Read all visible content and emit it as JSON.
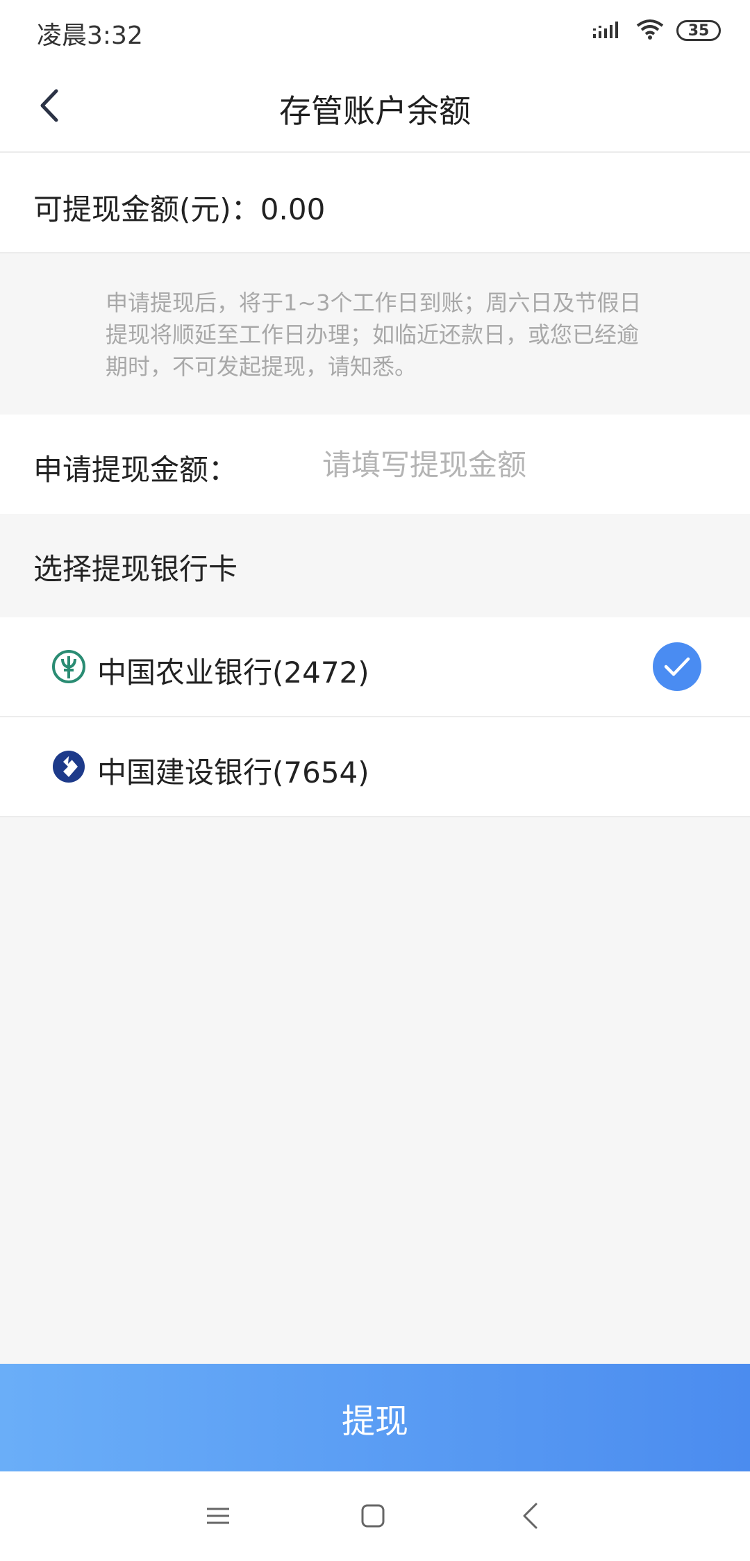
{
  "status_bar": {
    "time": "凌晨3:32",
    "battery": "35"
  },
  "header": {
    "title": "存管账户余额"
  },
  "balance": {
    "label": "可提现金额(元)：0.00"
  },
  "notice": {
    "text": "申请提现后，将于1~3个工作日到账；周六日及节假日提现将顺延至工作日办理；如临近还款日，或您已经逾期时，不可发起提现，请知悉。"
  },
  "withdraw_form": {
    "label": "申请提现金额：",
    "placeholder": "请填写提现金额",
    "value": ""
  },
  "bank_section": {
    "title": "选择提现银行卡",
    "cards": [
      {
        "name": "中国农业银行(2472)",
        "icon": "abc-bank-logo-icon",
        "selected": true,
        "color": "#2a8c73"
      },
      {
        "name": "中国建设银行(7654)",
        "icon": "ccb-bank-logo-icon",
        "selected": false,
        "color": "#1d3a8a"
      }
    ]
  },
  "submit": {
    "label": "提现"
  },
  "colors": {
    "accent": "#4a8cf2",
    "button_gradient_start": "#6aaef8",
    "button_gradient_end": "#4b8cef"
  }
}
